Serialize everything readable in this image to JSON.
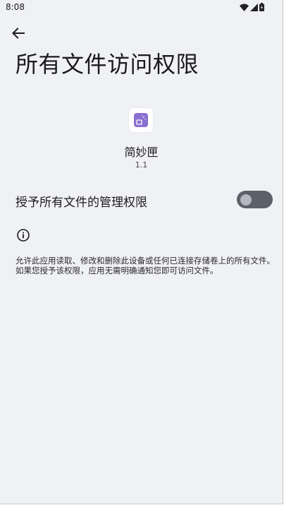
{
  "status_bar": {
    "time": "8:08",
    "icons": [
      "wifi-icon",
      "signal-icon",
      "battery-icon"
    ]
  },
  "header": {
    "back_icon": "arrow-left-icon",
    "title": "所有文件访问权限"
  },
  "app": {
    "icon": "app-icon",
    "name": "简妙匣",
    "version": "1.1"
  },
  "permission": {
    "label": "授予所有文件的管理权限",
    "enabled": false
  },
  "info": {
    "icon": "info-icon",
    "description": "允许此应用读取、修改和删除此设备或任何已连接存储卷上的所有文件。如果您授予该权限，应用无需明确通知您即可访问文件。"
  },
  "colors": {
    "background": "#f0f1f4",
    "toggle_track": "#5b6069",
    "toggle_thumb": "#b4b7bd",
    "app_icon_accent": "#8a6fd1"
  }
}
